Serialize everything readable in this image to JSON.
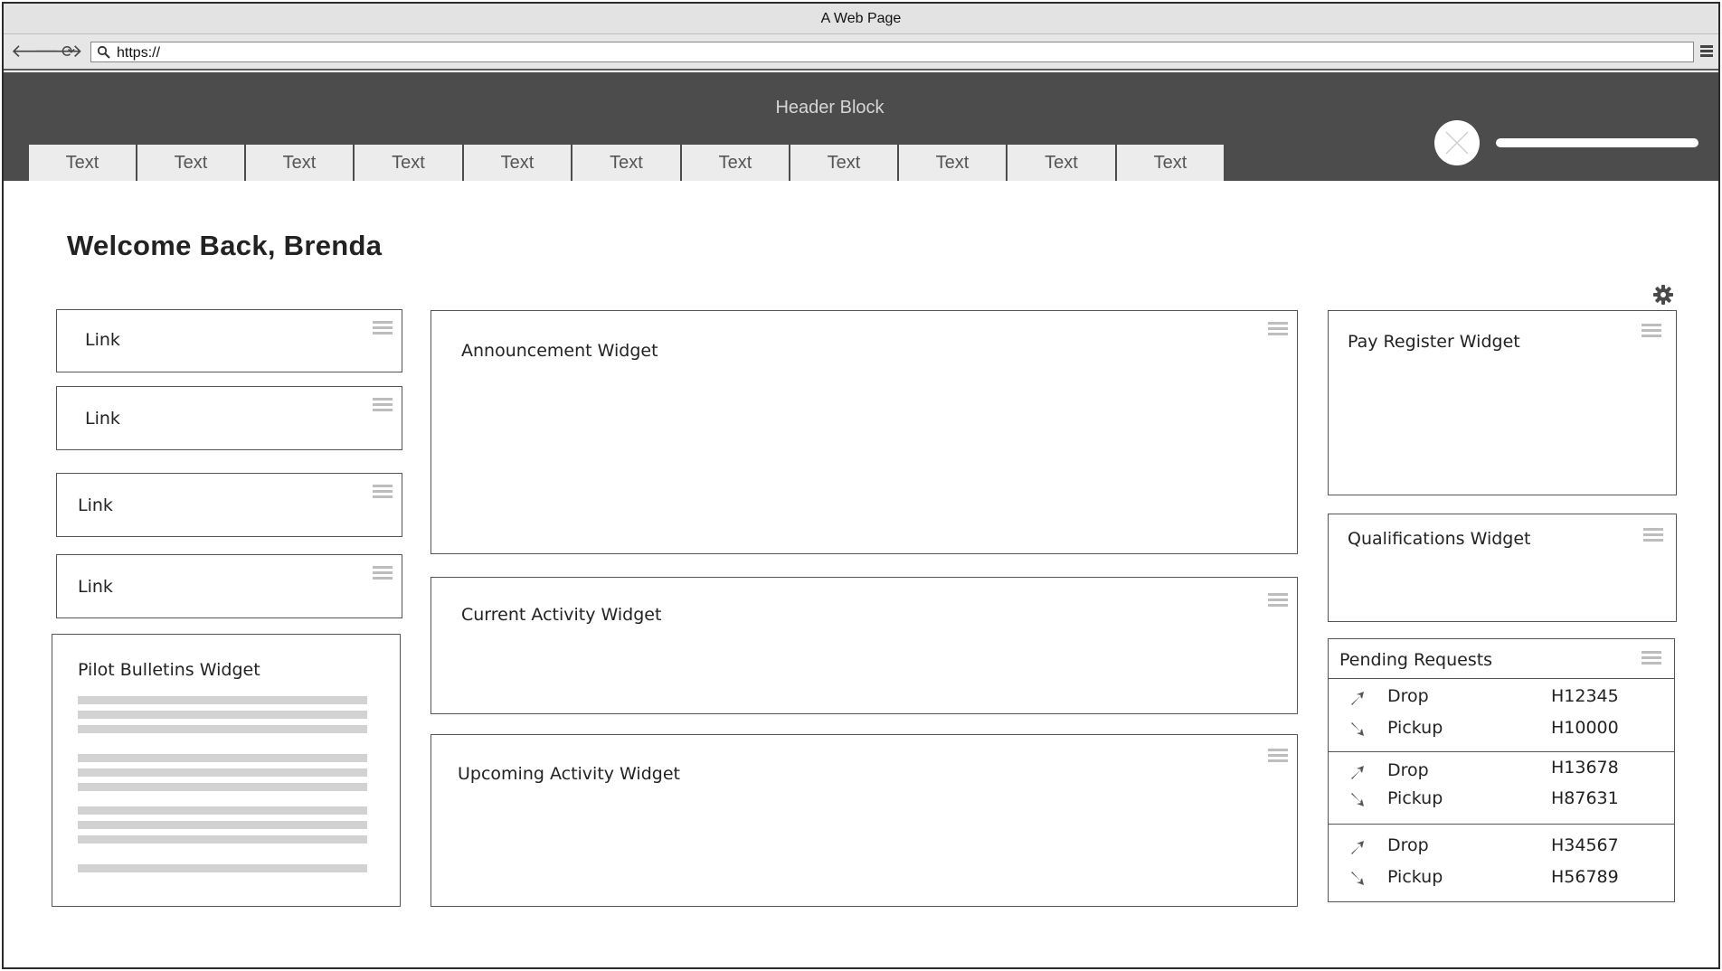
{
  "browser": {
    "window_title": "A Web Page",
    "url": "https://"
  },
  "header": {
    "title": "Header Block",
    "tabs": [
      "Text",
      "Text",
      "Text",
      "Text",
      "Text",
      "Text",
      "Text",
      "Text",
      "Text",
      "Text",
      "Text"
    ]
  },
  "main": {
    "welcome": "Welcome Back, Brenda",
    "links": [
      "Link",
      "Link",
      "Link",
      "Link"
    ],
    "widgets": {
      "pilot_bulletins": "Pilot Bulletins Widget",
      "announcement": "Announcement Widget",
      "current_activity": "Current Activity Widget",
      "upcoming_activity": "Upcoming Activity Widget",
      "pay_register": "Pay Register Widget",
      "qualifications": "Qualifications Widget"
    },
    "pending_requests": {
      "title": "Pending Requests",
      "groups": [
        [
          {
            "type": "Drop",
            "code": "H12345"
          },
          {
            "type": "Pickup",
            "code": "H10000"
          }
        ],
        [
          {
            "type": "Drop",
            "code": "H13678"
          },
          {
            "type": "Pickup",
            "code": "H87631"
          }
        ],
        [
          {
            "type": "Drop",
            "code": "H34567"
          },
          {
            "type": "Pickup",
            "code": "H56789"
          }
        ]
      ]
    }
  }
}
